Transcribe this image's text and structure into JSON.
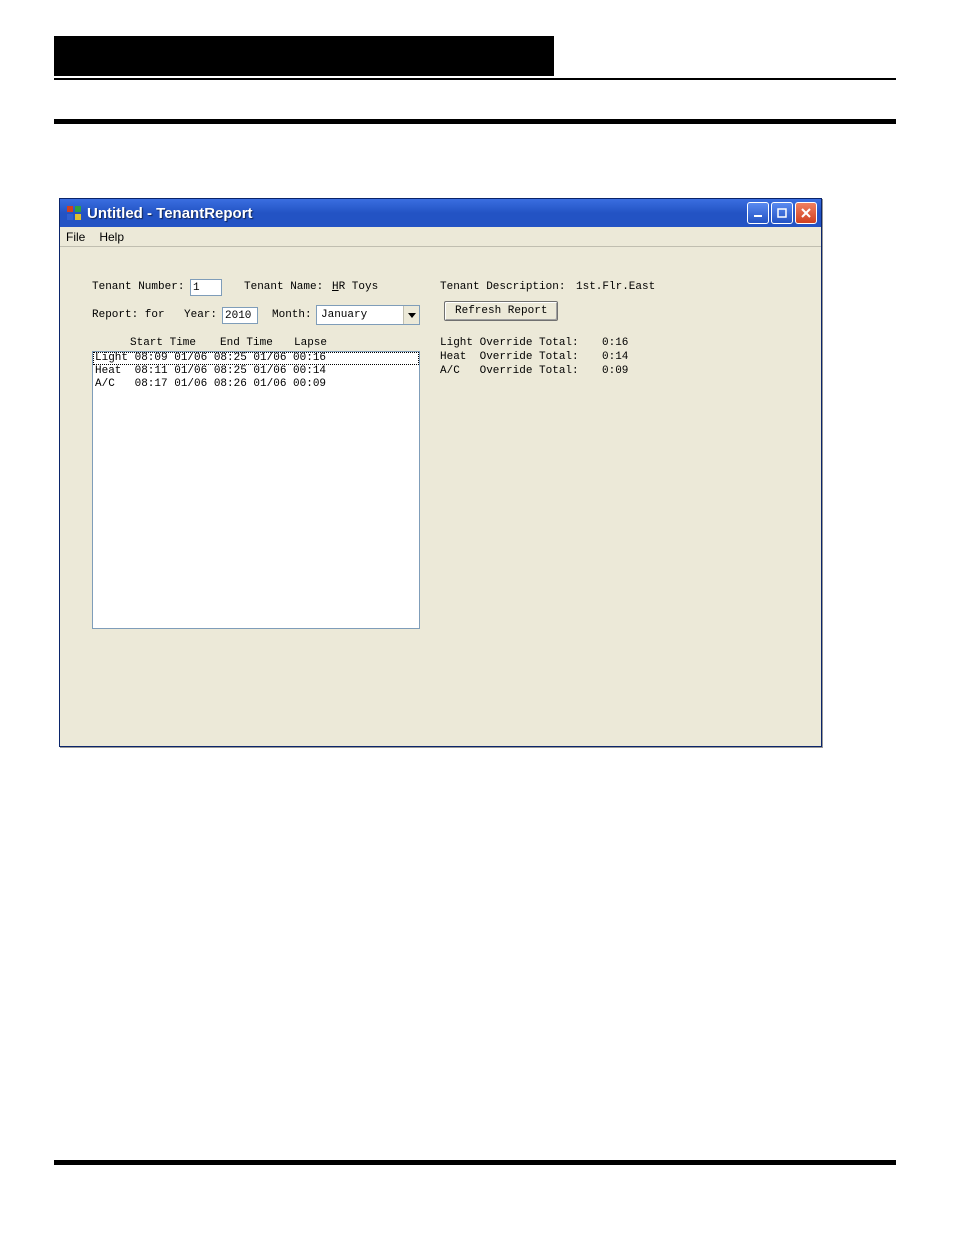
{
  "window": {
    "title": "Untitled - TenantReport"
  },
  "menu": {
    "file": "File",
    "help": "Help"
  },
  "labels": {
    "tenant_number": "Tenant Number:",
    "tenant_name_label": "Tenant Name:",
    "tenant_name_value": "HR Toys",
    "tenant_desc_label": "Tenant Description:",
    "tenant_desc_value": "1st.Flr.East",
    "report_for": "Report: for",
    "year_label": "Year:",
    "month_label": "Month:",
    "refresh": "Refresh Report",
    "col_start": "Start Time",
    "col_end": "End Time",
    "col_lapse": "Lapse",
    "light_total_label": "Light Override Total:",
    "light_total_value": "0:16",
    "heat_total_label": "Heat  Override Total:",
    "heat_total_value": "0:14",
    "ac_total_label": "A/C   Override Total:",
    "ac_total_value": "0:09"
  },
  "inputs": {
    "tenant_number": "1",
    "year": "2010",
    "month": "January"
  },
  "list": {
    "row1": "Light 08:09 01/06 08:25 01/06 00:16",
    "row2": "Heat  08:11 01/06 08:25 01/06 00:14",
    "row3": "A/C   08:17 01/06 08:26 01/06 00:09"
  }
}
